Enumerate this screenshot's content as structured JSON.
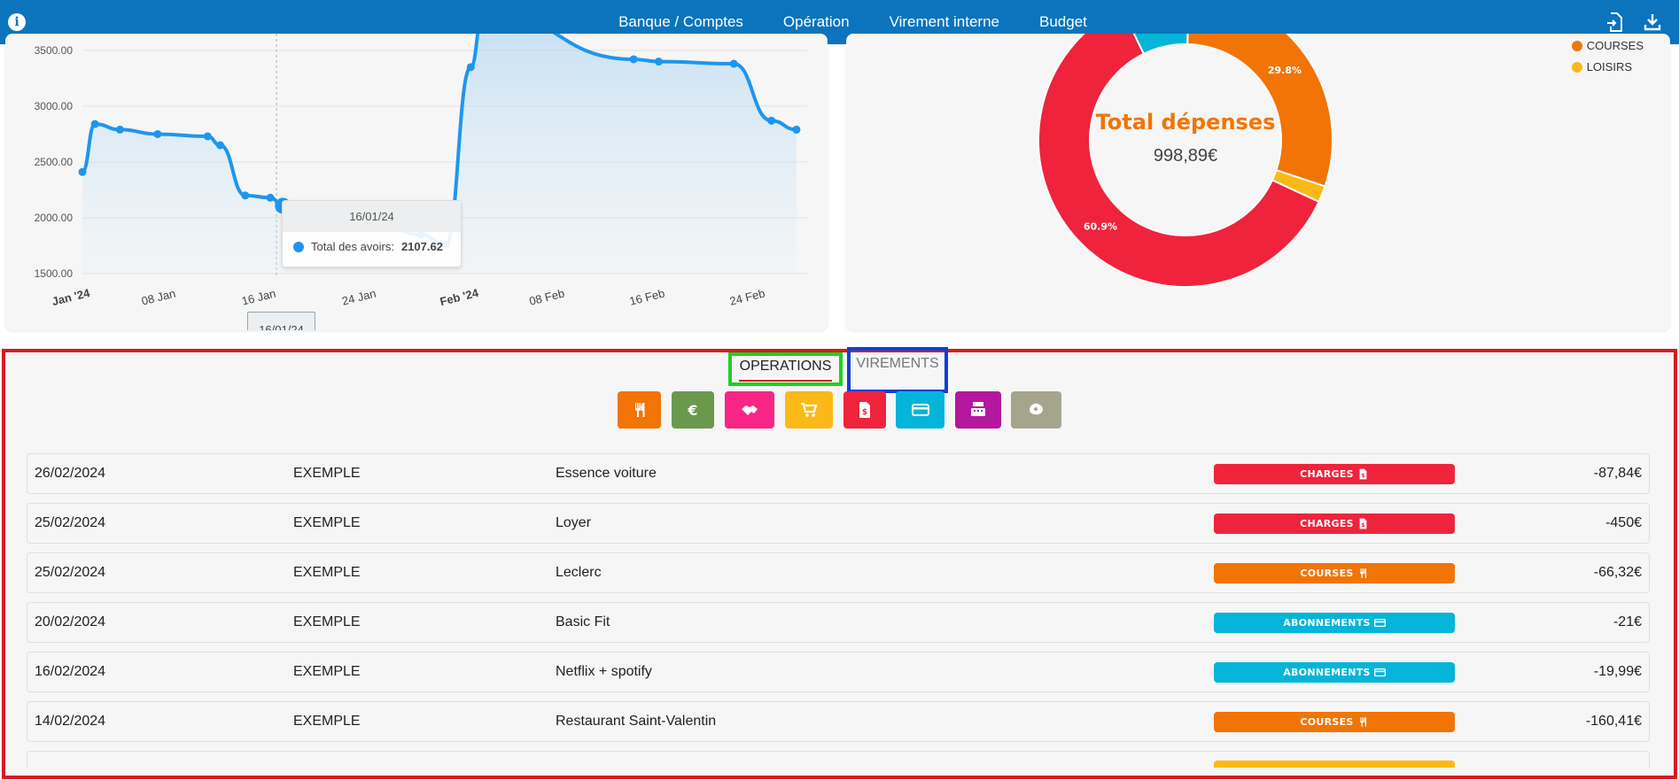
{
  "navbar": {
    "links": [
      "Banque / Comptes",
      "Opération",
      "Virement interne",
      "Budget"
    ]
  },
  "line_chart": {
    "chart_data": {
      "type": "area",
      "series": [
        {
          "name": "Total des avoirs",
          "points": [
            [
              "2024-01-01",
              2410
            ],
            [
              "2024-01-02",
              2840
            ],
            [
              "2024-01-04",
              2790
            ],
            [
              "2024-01-07",
              2750
            ],
            [
              "2024-01-11",
              2730
            ],
            [
              "2024-01-12",
              2650
            ],
            [
              "2024-01-14",
              2200
            ],
            [
              "2024-01-16",
              2180
            ],
            [
              "2024-01-17",
              2107.62
            ],
            [
              "2024-01-20",
              2080
            ],
            [
              "2024-01-25",
              1920
            ],
            [
              "2024-01-28",
              1850
            ],
            [
              "2024-01-30",
              1760
            ],
            [
              "2024-02-01",
              3350
            ],
            [
              "2024-02-02",
              3850
            ],
            [
              "2024-02-14",
              3420
            ],
            [
              "2024-02-16",
              3400
            ],
            [
              "2024-02-22",
              3380
            ],
            [
              "2024-02-25",
              2870
            ],
            [
              "2024-02-27",
              2790
            ]
          ]
        }
      ],
      "y_ticks": [
        "1500.00",
        "2000.00",
        "2500.00",
        "3000.00",
        "3500.00"
      ],
      "ylim": [
        1500,
        3650
      ],
      "x_ticks": [
        "Jan '24",
        "08 Jan",
        "16 Jan",
        "24 Jan",
        "Feb '24",
        "08 Feb",
        "16 Feb",
        "24 Feb"
      ],
      "grid": true,
      "color": "#1e96ef"
    },
    "tooltip": {
      "date": "16/01/24",
      "label": "Total des avoirs:",
      "value": "2107.62"
    },
    "crosshair_label": "16/01/24"
  },
  "donut_chart": {
    "chart_data": {
      "type": "pie",
      "donut": true,
      "slices": [
        {
          "label": "",
          "value": 60.9,
          "color": "#ef233c"
        },
        {
          "label": "",
          "value": 7.5,
          "color": "#03b5d8"
        },
        {
          "label": "COURSES",
          "value": 29.8,
          "color": "#f27405"
        },
        {
          "label": "LOISIRS",
          "value": 1.8,
          "color": "#fbb917"
        }
      ],
      "slice_labels": [
        "60.9%",
        "7.5%",
        "29.8%"
      ]
    },
    "center_title": "Total dépenses",
    "center_value": "998,89€",
    "legend": [
      {
        "label": "COURSES",
        "color": "#f27405"
      },
      {
        "label": "LOISIRS",
        "color": "#fbb917"
      }
    ]
  },
  "tabs": {
    "operations": "OPERATIONS",
    "virements": "VIREMENTS"
  },
  "categories": [
    {
      "icon": "fork-knife-icon",
      "color": "#f27405"
    },
    {
      "icon": "euro-icon",
      "color": "#6a994e"
    },
    {
      "icon": "handshake-icon",
      "color": "#f72585"
    },
    {
      "icon": "cart-icon",
      "color": "#fbb917"
    },
    {
      "icon": "bill-icon",
      "color": "#ef233c"
    },
    {
      "icon": "credit-card-icon",
      "color": "#03b5d8"
    },
    {
      "icon": "cash-register-icon",
      "color": "#b5179e"
    },
    {
      "icon": "misc-icon",
      "color": "#a5a58d"
    }
  ],
  "operations": [
    {
      "date": "26/02/2024",
      "account": "EXEMPLE",
      "description": "Essence voiture",
      "category": "CHARGES",
      "category_icon": "bill-icon",
      "category_color": "#ef233c",
      "amount": "-87,84€"
    },
    {
      "date": "25/02/2024",
      "account": "EXEMPLE",
      "description": "Loyer",
      "category": "CHARGES",
      "category_icon": "bill-icon",
      "category_color": "#ef233c",
      "amount": "-450€"
    },
    {
      "date": "25/02/2024",
      "account": "EXEMPLE",
      "description": "Leclerc",
      "category": "COURSES",
      "category_icon": "fork-knife-icon",
      "category_color": "#f27405",
      "amount": "-66,32€"
    },
    {
      "date": "20/02/2024",
      "account": "EXEMPLE",
      "description": "Basic Fit",
      "category": "ABONNEMENTS",
      "category_icon": "credit-card-icon",
      "category_color": "#03b5d8",
      "amount": "-21€"
    },
    {
      "date": "16/02/2024",
      "account": "EXEMPLE",
      "description": "Netflix + spotify",
      "category": "ABONNEMENTS",
      "category_icon": "credit-card-icon",
      "category_color": "#03b5d8",
      "amount": "-19,99€"
    },
    {
      "date": "14/02/2024",
      "account": "EXEMPLE",
      "description": "Restaurant Saint-Valentin",
      "category": "COURSES",
      "category_icon": "fork-knife-icon",
      "category_color": "#f27405",
      "amount": "-160,41€"
    }
  ]
}
